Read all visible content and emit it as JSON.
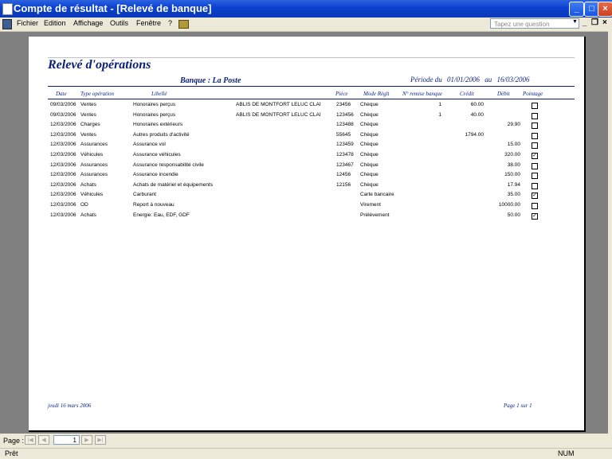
{
  "window": {
    "title": "Compte de résultat - [Relevé de banque]"
  },
  "menu": {
    "items": [
      "Fichier",
      "Edition",
      "Affichage",
      "Outils",
      "Fenêtre",
      "?"
    ],
    "question_placeholder": "Tapez une question"
  },
  "report": {
    "title": "Relevé d'opérations",
    "bank": "Banque : La Poste",
    "period_label": "Période du",
    "period_start": "01/01/2006",
    "period_sep": "au",
    "period_end": "16/03/2006",
    "headers": [
      "Date",
      "Type opération",
      "Libellé",
      "Pièce",
      "Mode Règlt",
      "N° remise banque",
      "Crédit",
      "Débit",
      "Pointage"
    ],
    "rows": [
      {
        "date": "09/03/2006",
        "type": "Ventes",
        "libelle": "Honoraires perçus",
        "tiers": "ABLIS DE MONTFORT LELUC CLAI",
        "piece": "23456",
        "mode": "Chèque",
        "remise": "1",
        "credit": "60.00",
        "debit": "",
        "pointage": false
      },
      {
        "date": "09/03/2006",
        "type": "Ventes",
        "libelle": "Honoraires perçus",
        "tiers": "ABLIS DE MONTFORT LELUC CLAI",
        "piece": "123456",
        "mode": "Chèque",
        "remise": "1",
        "credit": "40.00",
        "debit": "",
        "pointage": false
      },
      {
        "date": "12/03/2006",
        "type": "Charges",
        "libelle": "Honoraires extérieurs",
        "tiers": "",
        "piece": "123488",
        "mode": "Chèque",
        "remise": "",
        "credit": "",
        "debit": "29.90",
        "pointage": false
      },
      {
        "date": "12/03/2006",
        "type": "Ventes",
        "libelle": "Autres produits d'activité",
        "tiers": "",
        "piece": "55645",
        "mode": "Chèque",
        "remise": "",
        "credit": "1794.00",
        "debit": "",
        "pointage": false
      },
      {
        "date": "12/03/2006",
        "type": "Assurances",
        "libelle": "Assurance vol",
        "tiers": "",
        "piece": "123459",
        "mode": "Chèque",
        "remise": "",
        "credit": "",
        "debit": "15.00",
        "pointage": false
      },
      {
        "date": "12/03/2006",
        "type": "Véhicules",
        "libelle": "Assurance véhicules",
        "tiers": "",
        "piece": "123478",
        "mode": "Chèque",
        "remise": "",
        "credit": "",
        "debit": "320.00",
        "pointage": true
      },
      {
        "date": "12/03/2006",
        "type": "Assurances",
        "libelle": "Assurance responsabilité civile",
        "tiers": "",
        "piece": "123467",
        "mode": "Chèque",
        "remise": "",
        "credit": "",
        "debit": "38.00",
        "pointage": false
      },
      {
        "date": "12/03/2006",
        "type": "Assurances",
        "libelle": "Assurance incendie",
        "tiers": "",
        "piece": "12456",
        "mode": "Chèque",
        "remise": "",
        "credit": "",
        "debit": "150.00",
        "pointage": false
      },
      {
        "date": "12/03/2006",
        "type": "Achats",
        "libelle": "Achats de matériel et équipements",
        "tiers": "",
        "piece": "12156",
        "mode": "Chèque",
        "remise": "",
        "credit": "",
        "debit": "17.94",
        "pointage": false
      },
      {
        "date": "12/03/2006",
        "type": "Véhicules",
        "libelle": "Carburant",
        "tiers": "",
        "piece": "",
        "mode": "Carte bancaire",
        "remise": "",
        "credit": "",
        "debit": "35.00",
        "pointage": true
      },
      {
        "date": "12/03/2006",
        "type": "OD",
        "libelle": "Report à nouveau",
        "tiers": "",
        "piece": "",
        "mode": "Virement",
        "remise": "",
        "credit": "",
        "debit": "10000.00",
        "pointage": false
      },
      {
        "date": "12/03/2006",
        "type": "Achats",
        "libelle": "Energie: Eau, EDF, GDF",
        "tiers": "",
        "piece": "",
        "mode": "Prélèvement",
        "remise": "",
        "credit": "",
        "debit": "50.00",
        "pointage": true
      }
    ],
    "footer_date": "jeudi 16 mars 2006",
    "footer_page": "Page 1 sur 1"
  },
  "navigation": {
    "label": "Page :",
    "current_page": "1"
  },
  "status": {
    "text": "Prêt",
    "num": "NUM"
  }
}
